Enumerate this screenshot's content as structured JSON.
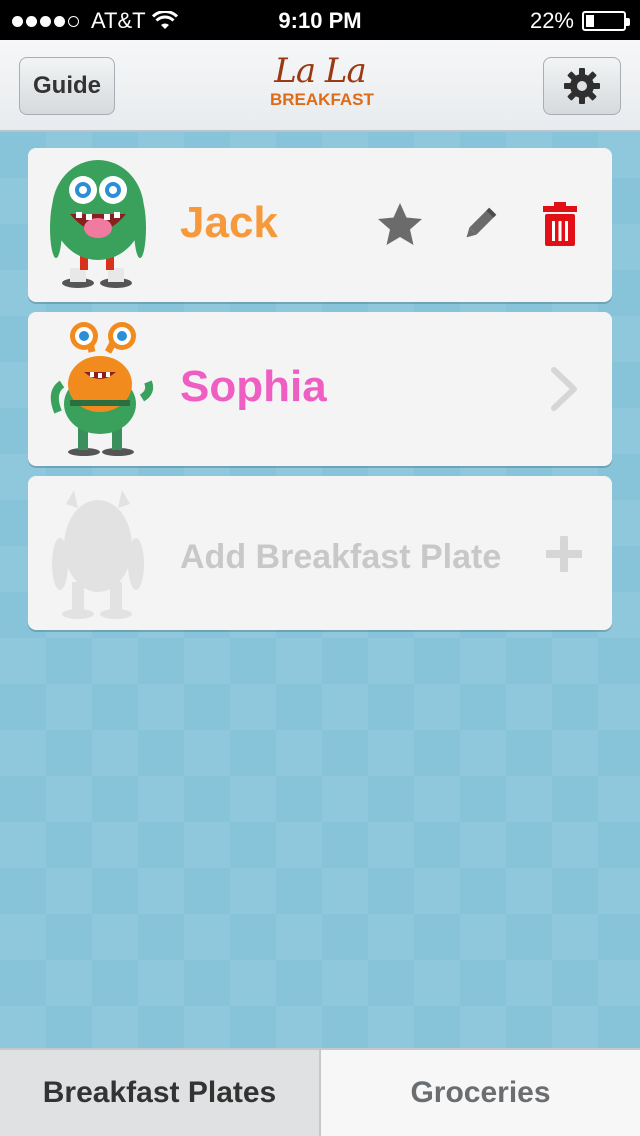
{
  "status_bar": {
    "carrier": "AT&T",
    "time": "9:10 PM",
    "battery_percent": "22%",
    "battery_level": 0.22,
    "signal_bars_filled": 4,
    "signal_bars_total": 5
  },
  "nav": {
    "guide_label": "Guide",
    "logo_script": "La La",
    "logo_word": "BREAKFAST",
    "settings_icon": "gear-icon"
  },
  "plates": [
    {
      "name": "Jack",
      "color": "#f7983a",
      "actions": [
        "star-icon",
        "pencil-icon",
        "trash-icon"
      ]
    },
    {
      "name": "Sophia",
      "color": "#ef5fc3",
      "actions": [
        "chevron-right-icon"
      ]
    }
  ],
  "add_plate": {
    "label": "Add Breakfast Plate",
    "icon": "plus-icon"
  },
  "tabs": [
    {
      "label": "Breakfast Plates",
      "active": true
    },
    {
      "label": "Groceries",
      "active": false
    }
  ],
  "colors": {
    "background": "#87c4d9",
    "trash": "#e10f16",
    "icon_gray": "#6b6b6b",
    "placeholder_gray": "#c8c8c8"
  }
}
